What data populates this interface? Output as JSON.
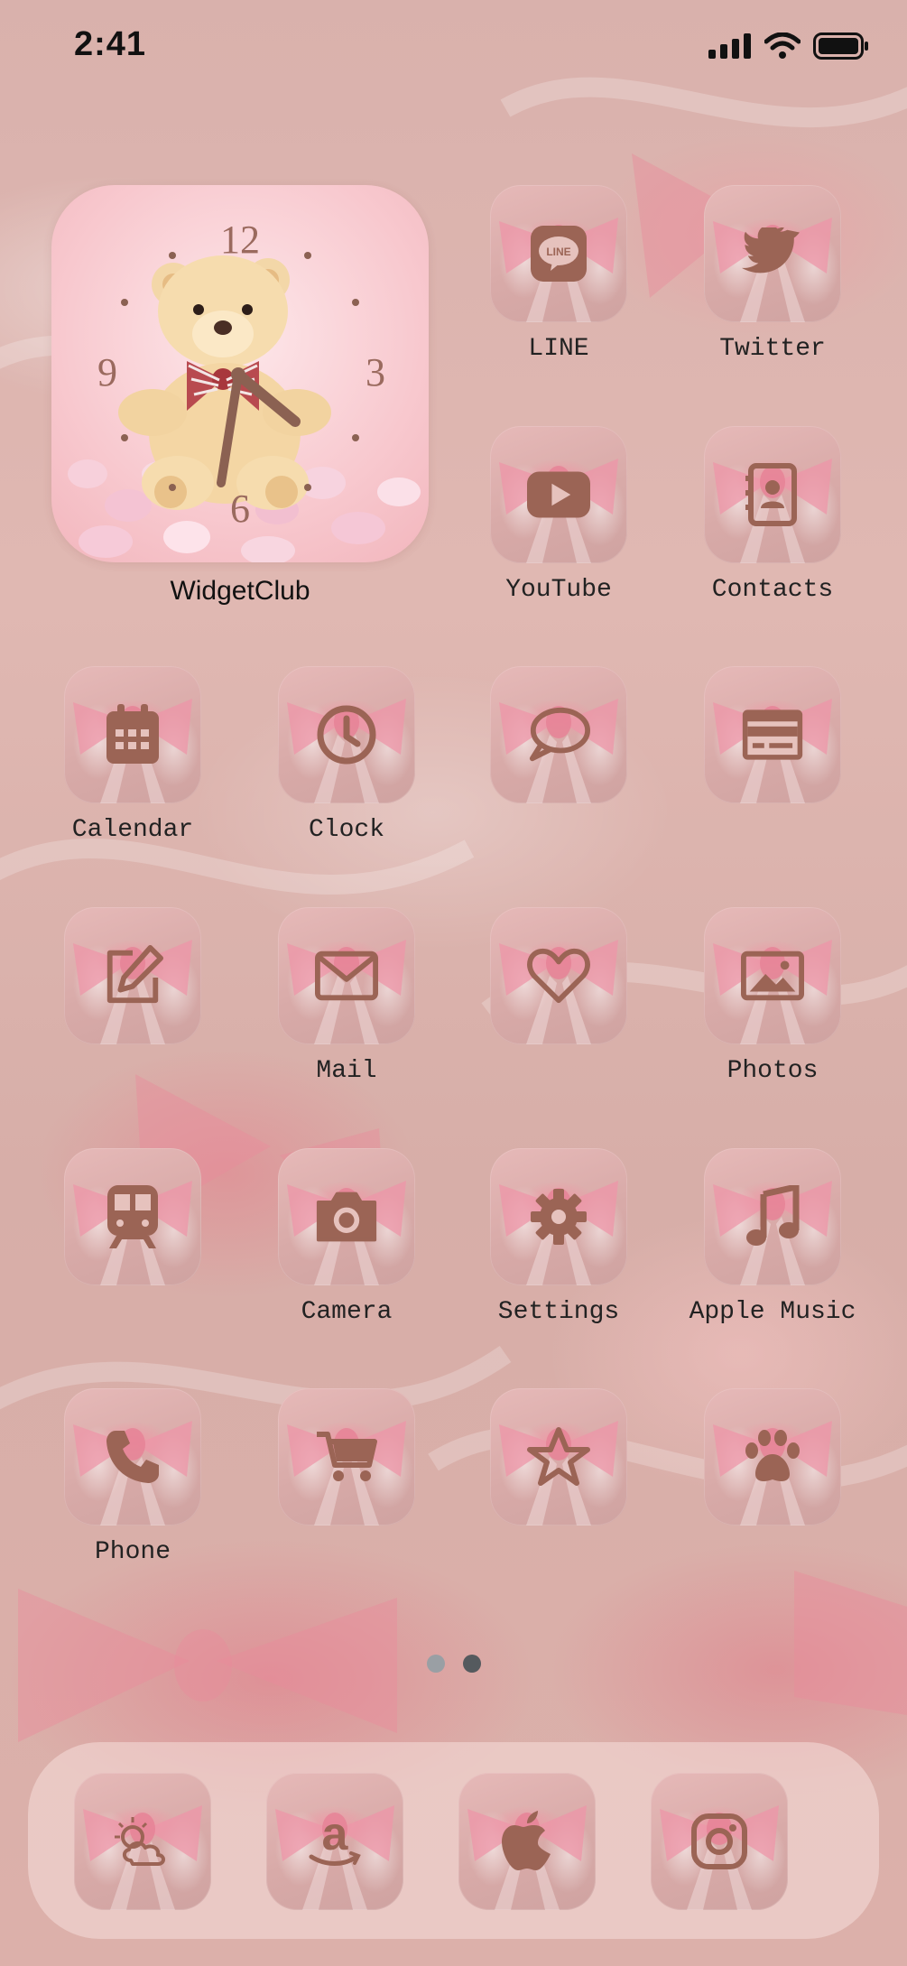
{
  "status_bar": {
    "time": "2:41"
  },
  "widget": {
    "label": "WidgetClub",
    "clock_numbers": {
      "n12": "12",
      "n3": "3",
      "n6": "6",
      "n9": "9"
    },
    "colors": {
      "numbers": "#9a6a5e",
      "hands": "#8b6152"
    }
  },
  "apps": [
    {
      "label": "LINE",
      "icon": "line-icon"
    },
    {
      "label": "Twitter",
      "icon": "twitter-bird-icon"
    },
    {
      "label": "YouTube",
      "icon": "youtube-play-icon"
    },
    {
      "label": "Contacts",
      "icon": "contacts-book-icon"
    },
    {
      "label": "Calendar",
      "icon": "calendar-icon"
    },
    {
      "label": "Clock",
      "icon": "clock-icon"
    },
    {
      "label": "",
      "icon": "speech-bubble-icon"
    },
    {
      "label": "",
      "icon": "browser-window-icon"
    },
    {
      "label": "",
      "icon": "pencil-note-icon"
    },
    {
      "label": "Mail",
      "icon": "mail-envelope-icon"
    },
    {
      "label": "",
      "icon": "heart-icon"
    },
    {
      "label": "Photos",
      "icon": "photo-icon"
    },
    {
      "label": "",
      "icon": "train-icon"
    },
    {
      "label": "Camera",
      "icon": "camera-icon"
    },
    {
      "label": "Settings",
      "icon": "gear-icon"
    },
    {
      "label": "Apple Music",
      "icon": "music-note-icon"
    },
    {
      "label": "Phone",
      "icon": "phone-icon"
    },
    {
      "label": "",
      "icon": "shopping-cart-icon"
    },
    {
      "label": "",
      "icon": "star-icon"
    },
    {
      "label": "",
      "icon": "paw-icon"
    }
  ],
  "dock": [
    {
      "icon": "weather-icon"
    },
    {
      "icon": "amazon-icon"
    },
    {
      "icon": "apple-icon"
    },
    {
      "icon": "instagram-icon"
    }
  ],
  "page_indicator": {
    "pages": 2,
    "current": 2
  },
  "colors": {
    "glyph": "#9b6455",
    "label": "#222222",
    "dot_active": "#555a5e",
    "dot_inactive": "#9a9fa4"
  }
}
